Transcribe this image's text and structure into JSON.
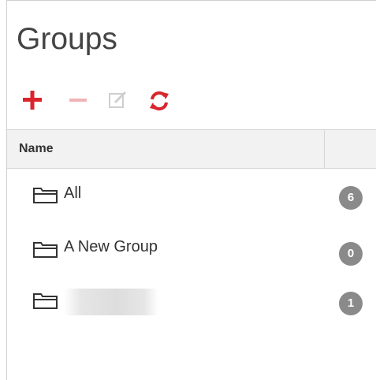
{
  "panel": {
    "title": "Groups",
    "toolbar": {
      "add_icon": "plus-icon",
      "remove_icon": "minus-icon",
      "edit_icon": "edit-icon",
      "refresh_icon": "refresh-icon"
    },
    "table": {
      "columns": [
        "Name",
        ""
      ],
      "rows": [
        {
          "icon": "folder-icon",
          "name": "All",
          "count": "6"
        },
        {
          "icon": "folder-icon",
          "name": "A New Group",
          "count": "0"
        },
        {
          "icon": "folder-icon",
          "name": "",
          "name_blurred": true,
          "count": "1"
        }
      ]
    }
  },
  "colors": {
    "accent_red": "#d9252b",
    "disabled_red": "#f1b3b5",
    "disabled_gray": "#cfcfcf",
    "badge_gray": "#8a8a8a",
    "header_bg": "#f2f2f2"
  }
}
